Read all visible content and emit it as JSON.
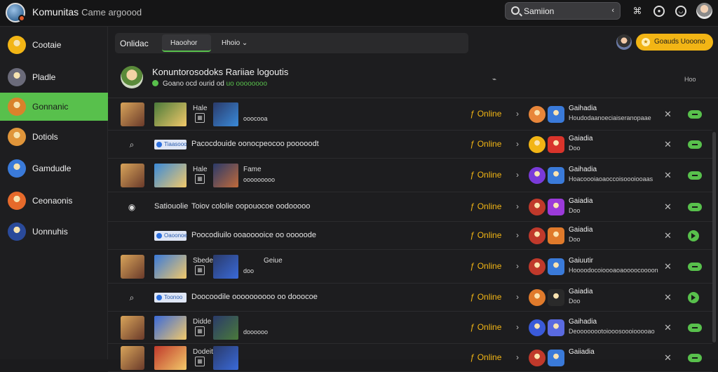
{
  "app": {
    "title": "Komunitas",
    "subtitle": "Came argoood"
  },
  "search": {
    "value": "Samiion",
    "placeholder": "Samiion"
  },
  "sidebar": {
    "items": [
      {
        "label": "Cootaie",
        "color": "#f2b515"
      },
      {
        "label": "Pladle",
        "color": "#6b6b7a"
      },
      {
        "label": "Gonnanic",
        "color": "#d9822b",
        "active": true
      },
      {
        "label": "Dotiols",
        "color": "#e0953a"
      },
      {
        "label": "Gamdudle",
        "color": "#3a7ad9"
      },
      {
        "label": "Ceonaonis",
        "color": "#e66a2b"
      },
      {
        "label": "Uonnuhis",
        "color": "#2a4a9a"
      }
    ]
  },
  "tabs": {
    "title": "Onlidac",
    "items": [
      "Haoohor",
      "Hhoio"
    ],
    "chevron": "⌄"
  },
  "action_button": {
    "label": "Goauds Uooono"
  },
  "header": {
    "title": "Konuntorosodoks Rariiae logoutis",
    "status": "Goano ocd ourid od",
    "status_count": "uo oooooooo",
    "sort_label": "⌁",
    "col_label": "Hoo"
  },
  "accent": "#58c04c",
  "highlight": "#f2b515",
  "rows": [
    {
      "type": "media",
      "label": "Hale",
      "sub": "ooocooa",
      "status": "Online",
      "pname": "Gaihadia",
      "pdesc": "Houdodaanoeciaiseranopaae",
      "cta": "toggle"
    },
    {
      "type": "text",
      "badge": "Tiaasooo",
      "label": "Pacocdouide oonocpeocoo pooooodt",
      "status": "Online",
      "pname": "Gaiadia",
      "pdesc": "Doo",
      "cta": "toggle"
    },
    {
      "type": "media",
      "label": "Hale",
      "sub": "ooooooooo",
      "mid": "Fame",
      "status": "Online",
      "pname": "Gaihadia",
      "pdesc": "Hoacoooiaoaoccoisoooiooaas",
      "cta": "toggle"
    },
    {
      "type": "text",
      "badge": "",
      "label": "Satiouolie",
      "label2": "Toiov cololie oopouocoe oodooooo",
      "status": "Online",
      "pname": "Gaiadia",
      "pdesc": "Doo",
      "cta": "toggle"
    },
    {
      "type": "text",
      "badge": "Oaoonoe",
      "label": "Poocodiuilo ooaooooice oo ooooode",
      "status": "Online",
      "pname": "Gaiadia",
      "pdesc": "Doo",
      "cta": "play"
    },
    {
      "type": "media",
      "label": "Sbede",
      "label2": "Geiue",
      "sub": "doo",
      "status": "Online",
      "pname": "Gaiuutir",
      "pdesc": "Hoooodocoioooaoaoooocoooon",
      "cta": "toggle"
    },
    {
      "type": "text",
      "badge": "Toonoo",
      "label": "Doocoodile oooooooooo oo dooocoe",
      "status": "Online",
      "pname": "Gaiadia",
      "pdesc": "Doo",
      "cta": "play"
    },
    {
      "type": "media",
      "label": "Didde",
      "sub": "doooooo",
      "status": "Online",
      "pname": "Gaihadia",
      "pdesc": "Deoooooootoiooosoooiooooao",
      "cta": "toggle"
    },
    {
      "type": "media",
      "label": "Dodeit",
      "sub": "",
      "status": "Online",
      "pname": "Gaiiadia",
      "pdesc": "",
      "cta": "toggle"
    }
  ]
}
